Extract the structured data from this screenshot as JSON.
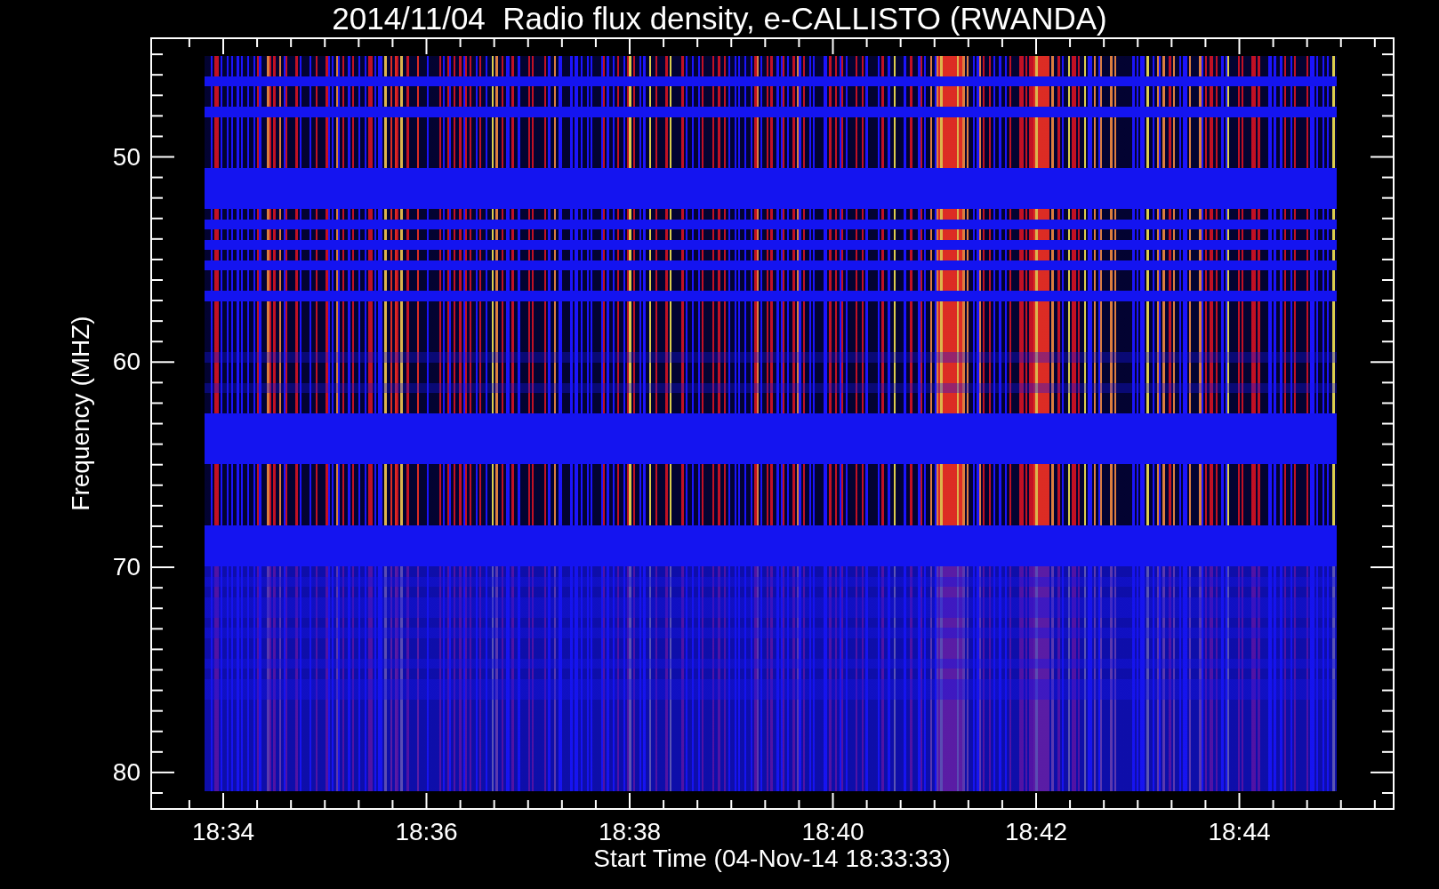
{
  "plot": {
    "title": "2014/11/04  Radio flux density, e-CALLISTO (RWANDA)",
    "y_axis": {
      "label": "Frequency (MHZ)",
      "tick_labels": [
        "50",
        "60",
        "70",
        "80"
      ]
    },
    "x_axis": {
      "label": "Start Time (04-Nov-14 18:33:33)",
      "tick_labels": [
        "18:34",
        "18:36",
        "18:38",
        "18:40",
        "18:42",
        "18:44"
      ]
    }
  }
}
